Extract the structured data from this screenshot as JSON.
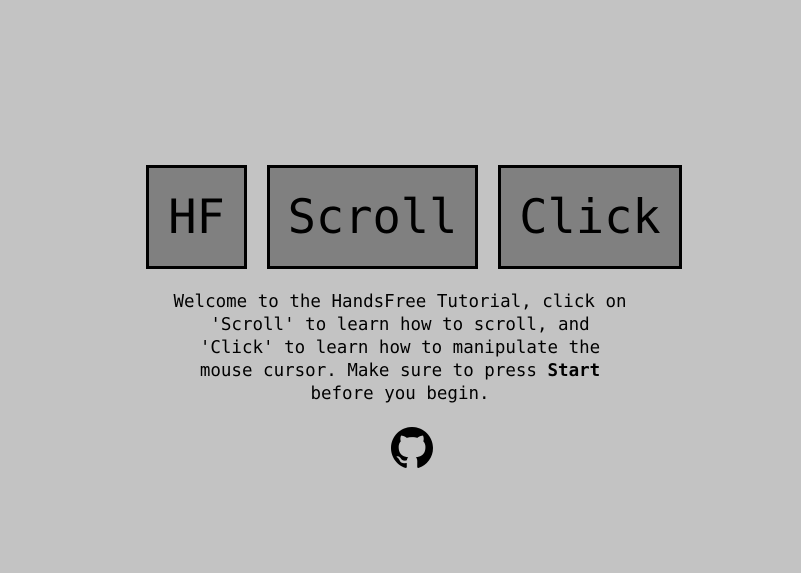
{
  "buttons": {
    "hf_label": "HF",
    "scroll_label": "Scroll",
    "click_label": "Click"
  },
  "intro": {
    "text_before": "Welcome to the HandsFree Tutorial, click on\n'Scroll' to learn how to scroll, and\n'Click' to learn how to manipulate the\nmouse cursor. Make sure to press ",
    "start_word": "Start",
    "text_after": "\nbefore you begin."
  },
  "footer": {
    "icon": "github-icon"
  },
  "colors": {
    "background": "#c3c3c3",
    "button_fill": "#808080",
    "border": "#000000"
  }
}
